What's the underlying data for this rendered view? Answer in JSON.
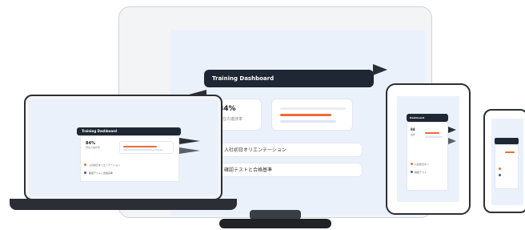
{
  "dashboard": {
    "title": "Training Dashboard",
    "stat_value": "84%",
    "stat_label": "現在の進捗率",
    "progress_fraction": 0.84,
    "items": [
      {
        "label": "入社初日オリエンテーション",
        "status_color": "#f06a35"
      },
      {
        "label": "確認テストと合格基準",
        "status_color": "#3a5a98"
      }
    ]
  },
  "tablet": {
    "title": "Dashboard",
    "stat_value": "84",
    "stat_label": "進捗",
    "items": [
      "入社初日オリ",
      "確認テスト"
    ]
  },
  "colors": {
    "titlebar": "#1e2733",
    "accent_orange": "#f06a35",
    "accent_blue": "#3a5a98",
    "screen_bg": "#eaf1fb",
    "frame_dark": "#2b2f35"
  }
}
